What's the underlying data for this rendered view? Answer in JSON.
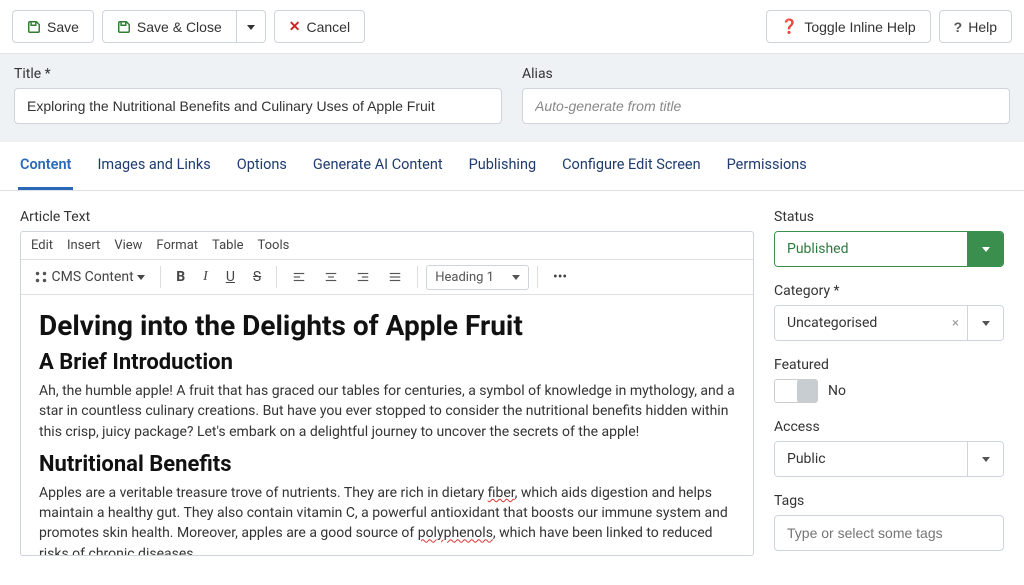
{
  "toolbar": {
    "save": "Save",
    "save_close": "Save & Close",
    "cancel": "Cancel",
    "toggle_help": "Toggle Inline Help",
    "help": "Help"
  },
  "header": {
    "title_label": "Title *",
    "title_value": "Exploring the Nutritional Benefits and Culinary Uses of Apple Fruit",
    "alias_label": "Alias",
    "alias_placeholder": "Auto-generate from title"
  },
  "tabs": [
    "Content",
    "Images and Links",
    "Options",
    "Generate AI Content",
    "Publishing",
    "Configure Edit Screen",
    "Permissions"
  ],
  "editor": {
    "label": "Article Text",
    "menubar": [
      "Edit",
      "Insert",
      "View",
      "Format",
      "Table",
      "Tools"
    ],
    "cms_content": "CMS Content",
    "heading_select": "Heading 1",
    "body_h1": "Delving into the Delights of Apple Fruit",
    "body_h2a": "A Brief Introduction",
    "body_p1": "Ah, the humble apple! A fruit that has graced our tables for centuries, a symbol of knowledge in mythology, and a star in countless culinary creations. But have you ever stopped to consider the nutritional benefits hidden within this crisp, juicy package? Let's embark on a delightful journey to uncover the secrets of the apple!",
    "body_h2b": "Nutritional Benefits",
    "body_p2a": "Apples are a veritable treasure trove of nutrients. They are rich in dietary ",
    "body_p2_fiber": "fiber",
    "body_p2b": ", which aids digestion and helps maintain a healthy gut. They also contain vitamin C, a powerful antioxidant that boosts our immune system and promotes skin health. Moreover, apples are a good source of ",
    "body_p2_poly": "polyphenols",
    "body_p2c": ", which have been linked to reduced risks of chronic diseases."
  },
  "sidebar": {
    "status_label": "Status",
    "status_value": "Published",
    "category_label": "Category *",
    "category_value": "Uncategorised",
    "featured_label": "Featured",
    "featured_value": "No",
    "access_label": "Access",
    "access_value": "Public",
    "tags_label": "Tags",
    "tags_placeholder": "Type or select some tags"
  }
}
